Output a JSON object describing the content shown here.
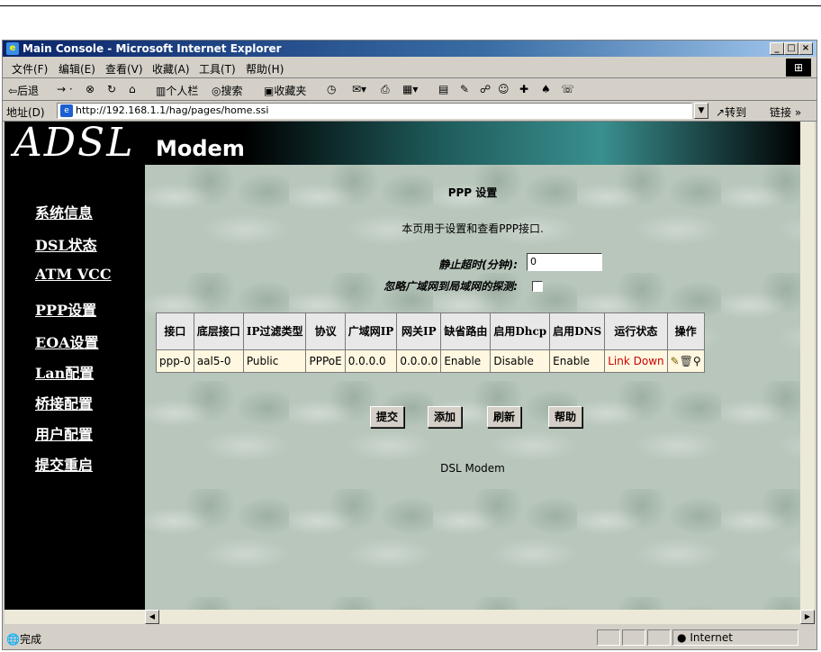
{
  "window": {
    "title": "Main Console - Microsoft Internet Explorer"
  },
  "menu": [
    "文件(F)",
    "编辑(E)",
    "查看(V)",
    "收藏(A)",
    "工具(T)",
    "帮助(H)"
  ],
  "toolbar": {
    "back": "⇦后退",
    "personal_bar": "个人栏",
    "search": "搜索",
    "favorites": "收藏夹"
  },
  "address": {
    "label": "地址(D)",
    "url": "http://192.168.1.1/hag/pages/home.ssi",
    "go": "转到",
    "links": "链接"
  },
  "banner": {
    "logo_adsl": "ADSL",
    "logo_modem": "Modem"
  },
  "sidebar": {
    "items": [
      "系统信息",
      "DSL状态",
      "ATM VCC",
      "PPP设置",
      "EOA设置",
      "Lan配置",
      "桥接配置",
      "用户配置",
      "提交重启"
    ]
  },
  "page": {
    "title": "PPP 设置",
    "description": "本页用于设置和查看PPP接口.",
    "idle_timeout_label": "静止超时(分钟):",
    "idle_timeout_value": "0",
    "ignore_label": "忽略广域网到局域网的探测:",
    "ignore_checked": false
  },
  "table": {
    "headers": [
      "接口",
      "底层接口",
      "IP过滤类型",
      "协议",
      "广域网IP",
      "网关IP",
      "缺省路由",
      "启用Dhcp",
      "启用DNS",
      "运行状态",
      "操作"
    ],
    "rows": [
      [
        "ppp-0",
        "aal5-0",
        "Public",
        "PPPoE",
        "0.0.0.0",
        "0.0.0.0",
        "Enable",
        "Disable",
        "Enable",
        "Link Down"
      ]
    ]
  },
  "buttons": {
    "submit": "提交",
    "add": "添加",
    "refresh": "刷新",
    "help": "帮助"
  },
  "footer": "DSL Modem",
  "status": {
    "left": "完成",
    "zone": "Internet"
  },
  "colors": {
    "link_down": "#cc0000",
    "title_bar": "#0a246a",
    "sidebar": "#000000"
  }
}
